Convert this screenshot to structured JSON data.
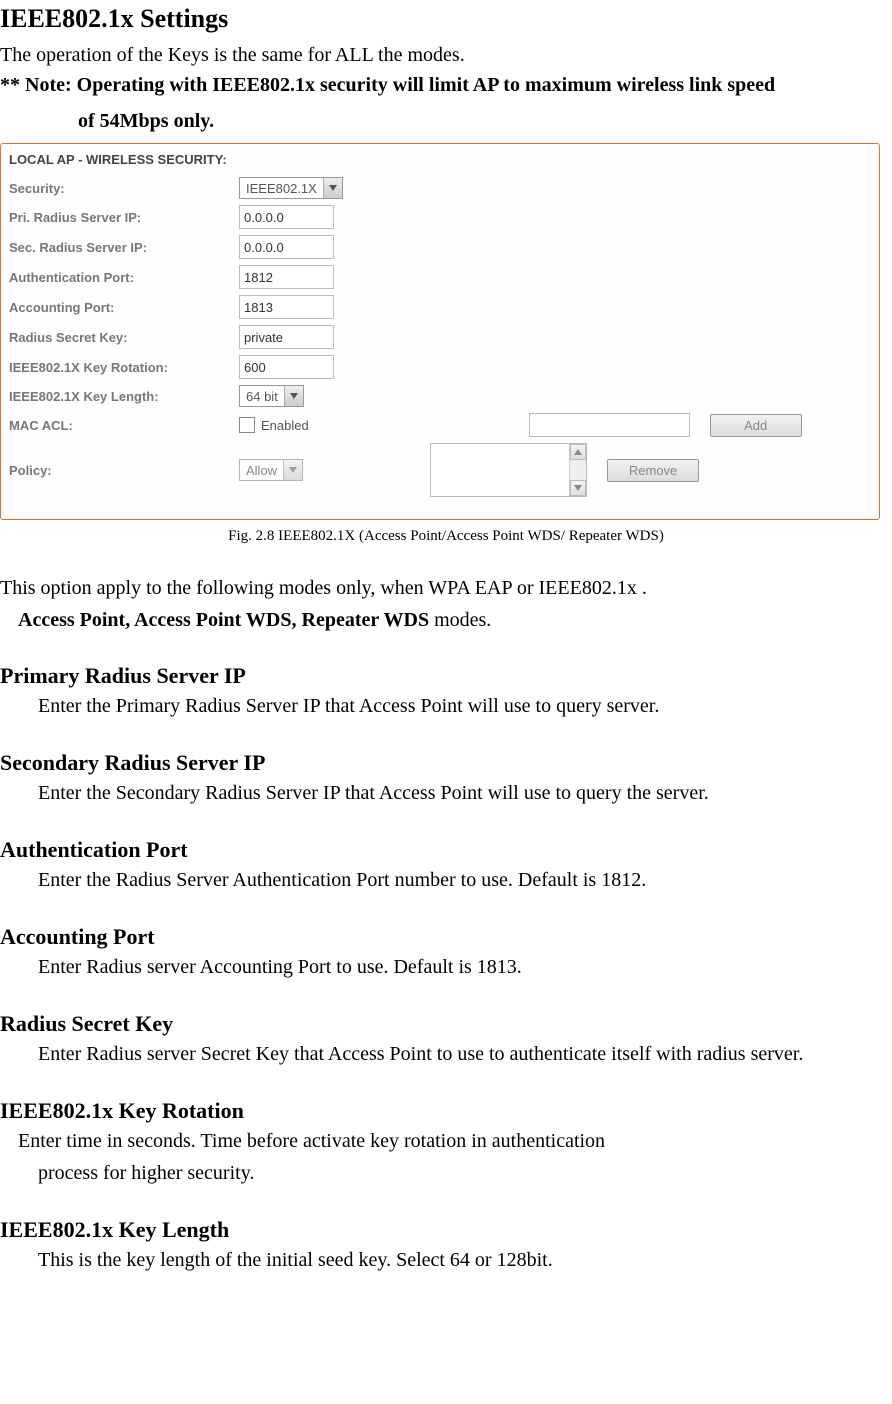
{
  "title": "IEEE802.1x Settings",
  "intro": "The operation of the Keys is the same for ALL the modes.",
  "note_line1": "** Note: Operating with IEEE802.1x security will limit AP to maximum wireless link speed",
  "note_line2": "of 54Mbps only.",
  "panel": {
    "heading": "LOCAL AP - WIRELESS SECURITY:",
    "labels": {
      "security": "Security:",
      "pri_radius": "Pri. Radius Server IP:",
      "sec_radius": "Sec. Radius Server IP:",
      "auth_port": "Authentication Port:",
      "acct_port": "Accounting Port:",
      "secret_key": "Radius Secret Key:",
      "key_rotation": "IEEE802.1X Key Rotation:",
      "key_length": "IEEE802.1X Key Length:",
      "mac_acl": "MAC ACL:",
      "policy": "Policy:"
    },
    "values": {
      "security": "IEEE802.1X",
      "pri_radius": "0.0.0.0",
      "sec_radius": "0.0.0.0",
      "auth_port": "1812",
      "acct_port": "1813",
      "secret_key": "private",
      "key_rotation": "600",
      "key_length": "64 bit",
      "mac_acl_enabled_label": "Enabled",
      "policy_select": "Allow"
    },
    "buttons": {
      "add": "Add",
      "remove": "Remove"
    }
  },
  "figure_caption": "Fig. 2.8 IEEE802.1X (Access Point/Access Point WDS/ Repeater WDS)",
  "apply_text": "This option apply to the following modes only, when WPA EAP or IEEE802.1x .",
  "modes_bold": "Access Point, Access Point WDS, Repeater WDS",
  "modes_rest": " modes.",
  "sections": {
    "pri": {
      "h": "Primary Radius Server IP",
      "d": "Enter the Primary Radius Server IP that Access Point will use to query server."
    },
    "sec": {
      "h": "Secondary Radius Server IP",
      "d": "Enter the Secondary Radius Server IP that Access Point will use to query the server."
    },
    "auth": {
      "h": "Authentication Port",
      "d": "Enter the Radius Server Authentication Port number to use. Default is 1812."
    },
    "acct": {
      "h": "Accounting Port",
      "d": "Enter Radius server Accounting Port to use. Default is 1813."
    },
    "secret": {
      "h": "Radius Secret Key",
      "d": "Enter Radius server Secret Key that Access Point to use to authenticate itself with radius server."
    },
    "rotation": {
      "h": "IEEE802.1x Key Rotation",
      "d1": "Enter time in seconds. Time before activate key rotation in authentication",
      "d2": "process for higher security."
    },
    "length": {
      "h": "IEEE802.1x Key Length",
      "d": "This is the key length of the initial seed key. Select 64 or 128bit."
    }
  }
}
